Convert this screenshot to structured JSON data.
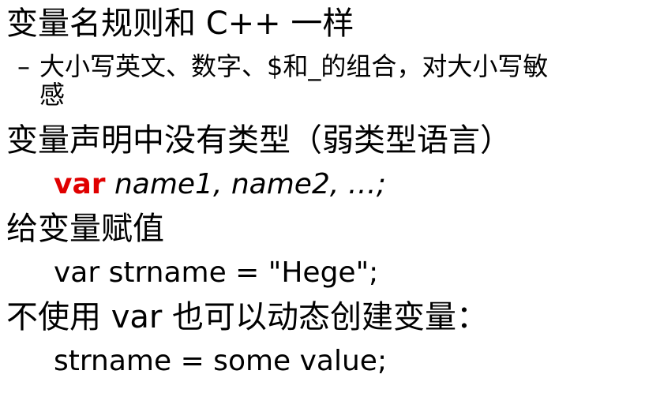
{
  "slide": {
    "heading1": "变量名规则和 C++ 一样",
    "bullet1_dash": "–",
    "bullet1_line1": "大小写英文、数字、$和_的组合，对大小写敏",
    "bullet1_line2": "感",
    "heading2": "变量声明中没有类型（弱类型语言）",
    "code1_keyword": "var",
    "code1_rest": " name1, name2, …;",
    "heading3": "给变量赋值",
    "code2": "var strname = \"Hege\";",
    "heading4": "不使用 var 也可以动态创建变量：",
    "code3": "strname = some value;"
  },
  "colors": {
    "keyword": "#e00000",
    "text": "#000000",
    "background": "#ffffff"
  }
}
